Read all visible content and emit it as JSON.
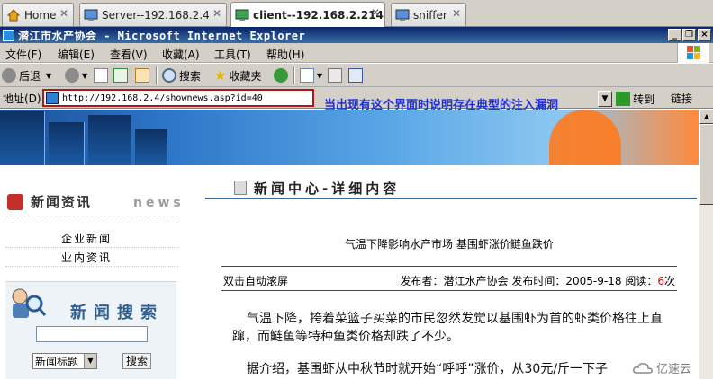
{
  "vm_tabs": [
    {
      "label": "Home"
    },
    {
      "label": "Server--192.168.2.4"
    },
    {
      "label": "client--192.168.2.214"
    },
    {
      "label": "sniffer"
    }
  ],
  "window": {
    "title": "潜江市水产协会 - Microsoft Internet Explorer",
    "minimize": "_",
    "restore": "❐",
    "close": "×"
  },
  "menu": [
    "文件(F)",
    "编辑(E)",
    "查看(V)",
    "收藏(A)",
    "工具(T)",
    "帮助(H)"
  ],
  "toolbar": {
    "back": "后退",
    "search": "搜索",
    "favorites": "收藏夹"
  },
  "address": {
    "label": "地址(D)",
    "url": "http://192.168.2.4/shownews.asp?id=40",
    "go": "转到",
    "links": "链接",
    "annotation": "当出现有这个界面时说明存在典型的注入漏洞"
  },
  "sidebar": {
    "news_title": "新闻资讯",
    "news_en": "news",
    "links": [
      "企业新闻",
      "业内资讯"
    ],
    "search_title": "新闻搜索",
    "search_select": "新闻标题",
    "search_button": "搜索"
  },
  "main": {
    "heading": "新闻中心-详细内容",
    "article_title": "气温下降影响水产市场 基围虾涨价鲢鱼跌价",
    "auto_scroll": "双击自动滚屏",
    "meta": {
      "publisher_label": "发布者：",
      "publisher": "潜江水产协会",
      "time_label": "发布时间：",
      "time": "2005-9-18",
      "reads_label": "阅读：",
      "reads": "6",
      "reads_unit": "次"
    },
    "para1_l1": "气温下降，挎着菜篮子买菜的市民忽然发觉以基围虾为首的虾类价格往上直",
    "para1_l2": "蹿，而鲢鱼等特种鱼类价格却跌了不少。",
    "para2": "据介绍，基围虾从中秋节时就开始“呼呼”涨价，从30元/斤一下子"
  },
  "watermark": "亿速云",
  "colors": {
    "titlebar": "#0a246a",
    "annotation": "#2030d0",
    "highlight_box": "#b01818",
    "reads_count": "#d01010"
  }
}
